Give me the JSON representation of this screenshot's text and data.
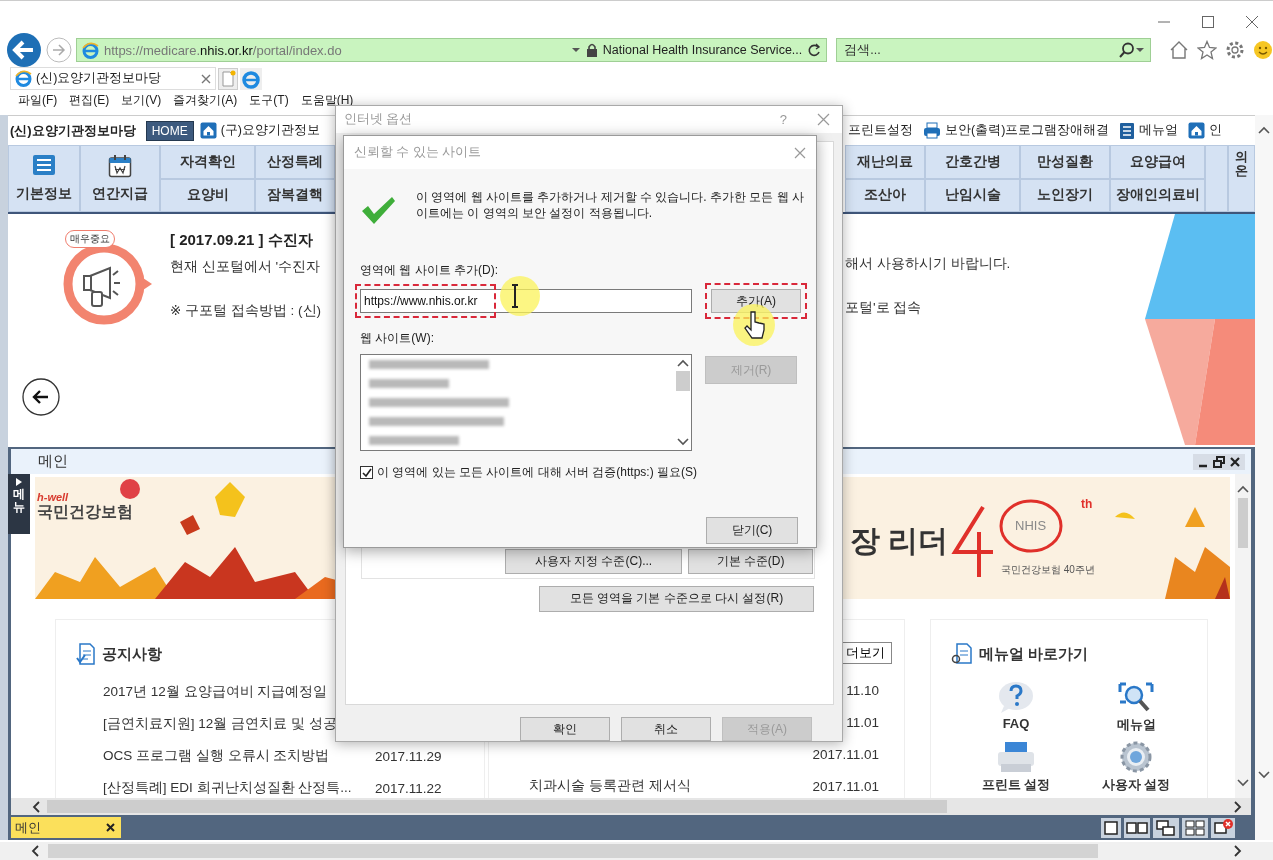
{
  "browser": {
    "address": "https://medicare.**nhis.or.kr**/portal/index.do",
    "site_identity": "National Health Insurance Service...",
    "search_placeholder": "검색...",
    "tabs": [
      {
        "title": "(신)요양기관정보마당",
        "selected": true
      }
    ],
    "menu": [
      "파일(F)",
      "편집(E)",
      "보기(V)",
      "즐겨찾기(A)",
      "도구(T)",
      "도움말(H)"
    ]
  },
  "site_bar": {
    "title": "(신)요양기관정보마당",
    "home_button": "HOME",
    "links_left": [
      {
        "kind": "home",
        "label": "(구)요양기관정보"
      }
    ],
    "links_right": [
      {
        "kind": "plain",
        "label": "프린트설정"
      },
      {
        "kind": "printer",
        "label": "보안(출력)프로그램장애해결"
      },
      {
        "kind": "manual",
        "label": "메뉴얼"
      },
      {
        "kind": "home",
        "label": "인"
      }
    ]
  },
  "nav": {
    "tiles": [
      {
        "kind": "list",
        "label": "기본정보"
      },
      {
        "kind": "calendar",
        "label": "연간지급"
      }
    ],
    "columns_left": [
      [
        "자격확인",
        "요양비"
      ],
      [
        "산정특례",
        "잠복결핵"
      ]
    ],
    "columns_right": [
      [
        "재난의료",
        "조산아"
      ],
      [
        "간호간병",
        "난임시술"
      ],
      [
        "만성질환",
        "노인장기"
      ],
      [
        "요양급여",
        "장애인의료비"
      ]
    ],
    "edge_label": "의온"
  },
  "notice": {
    "badge": "매우중요",
    "title": "[ 2017.09.21 ] 수진자",
    "line_1_start": "현재 신포털에서 '수진자",
    "line_1_end": "해서 사용하시기 바랍니다.",
    "line_2_start": "※ 구포털 접속방법 : (신)",
    "line_2_end": "포털'로 접속"
  },
  "main_panel": {
    "title": "메인",
    "side_tab": "메뉴",
    "banner": {
      "kind": "picture",
      "brand_tag": "h-well",
      "brand_name": "국민건강보험",
      "headline_fragment": "장 리더",
      "anniversary_mark": "NHIS",
      "anniversary_suffix": "th",
      "anniversary_caption": "국민건강보험 40주년"
    },
    "notices_card": {
      "title": "공지사항",
      "rows": [
        {
          "title": "2017년 12월 요양급여비 지급예정일"
        },
        {
          "title": "[금연치료지원] 12월 금연치료 및 성공"
        },
        {
          "title": "OCS 프로그램 실행 오류시 조치방법",
          "date": "2017.11.29"
        },
        {
          "title": "[산정특례] EDI 희귀난치성질환 산정특...",
          "date": "2017.11.22"
        }
      ]
    },
    "second_card": {
      "more_button": "더보기",
      "rows": [
        {
          "date": "11.10"
        },
        {
          "date": "11.01"
        },
        {
          "date": "2017.11.01"
        },
        {
          "title": "치과시술 등록관련 제서식",
          "date": "2017.11.01"
        }
      ]
    },
    "manual_card": {
      "title": "메뉴얼 바로가기",
      "items": [
        {
          "kind": "faq",
          "label": "FAQ"
        },
        {
          "kind": "search",
          "label": "메뉴얼"
        },
        {
          "kind": "printer",
          "label": "프린트 설정"
        },
        {
          "kind": "gear",
          "label": "사용자 설정"
        }
      ]
    }
  },
  "taskbar": {
    "tabs": [
      {
        "label": "메인",
        "selected": true
      }
    ]
  },
  "options_dialog": {
    "title": "인터넷 옵션",
    "help_glyph": "?",
    "zone_buttons": [
      {
        "label": "사용자 지정 수준(C)..."
      },
      {
        "label": "기본 수준(D)"
      }
    ],
    "reset_button": "모든 영역을 기본 수준으로 다시 설정(R)",
    "footer_buttons": [
      {
        "label": "확인",
        "disabled": false
      },
      {
        "label": "취소",
        "disabled": false
      },
      {
        "label": "적용(A)",
        "disabled": true
      }
    ]
  },
  "trusted_sites_dialog": {
    "title": "신뢰할 수 있는 사이트",
    "description": "이 영역에 웹 사이트를 추가하거나 제거할 수 있습니다. 추가한 모든 웹 사이트에는 이 영역의 보안 설정이 적용됩니다.",
    "add_field": {
      "label": "영역에 웹 사이트 추가(D):",
      "value": "https://www.nhis.or.kr",
      "highlighted": true
    },
    "add_button": {
      "label": "추가(A)",
      "disabled": false,
      "highlighted": true
    },
    "list_label": "웹 사이트(W):",
    "remove_button": {
      "label": "제거(R)",
      "disabled": true
    },
    "require_https": {
      "label": "이 영역에 있는 모든 사이트에 대해 서버 검증(https:) 필요(S)",
      "checked": true
    },
    "close_button": "닫기(C)"
  }
}
